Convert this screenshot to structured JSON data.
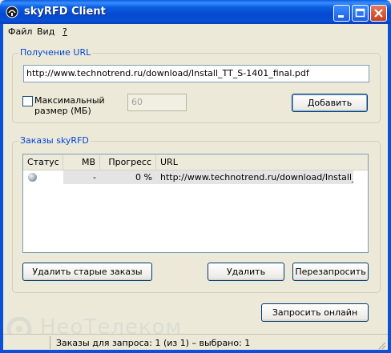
{
  "window": {
    "title": "skyRFD Client"
  },
  "menu": {
    "file": "Файл",
    "view": "Вид",
    "help": "?"
  },
  "url_group": {
    "legend": "Получение URL",
    "url_value": "http://www.technotrend.ru/download/Install_TT_S-1401_final.pdf",
    "max_size_label_line1": "Максимальный",
    "max_size_label_line2": "размер (МБ)",
    "max_size_checked": false,
    "max_size_value": "60",
    "add_button": "Добавить"
  },
  "orders_group": {
    "legend": "Заказы skyRFD",
    "columns": [
      "Статус",
      "MB",
      "Прогресс",
      "URL"
    ],
    "rows": [
      {
        "status_icon": "gray-circle-icon",
        "mb": "-",
        "progress": "0 %",
        "url": "http://www.technotrend.ru/download/Install_T..."
      }
    ],
    "delete_old_button": "Удалить старые заказы",
    "delete_button": "Удалить",
    "rerequest_button": "Перезапросить"
  },
  "request_online_button": "Запросить онлайн",
  "watermark": "НеоТелеком",
  "statusbar": {
    "text": "Заказы для запроса: 1 (из 1) – выбрано: 1"
  },
  "colors": {
    "titlebar": "#0a5fe0",
    "legend": "#0046d5",
    "face": "#ece9d8"
  }
}
